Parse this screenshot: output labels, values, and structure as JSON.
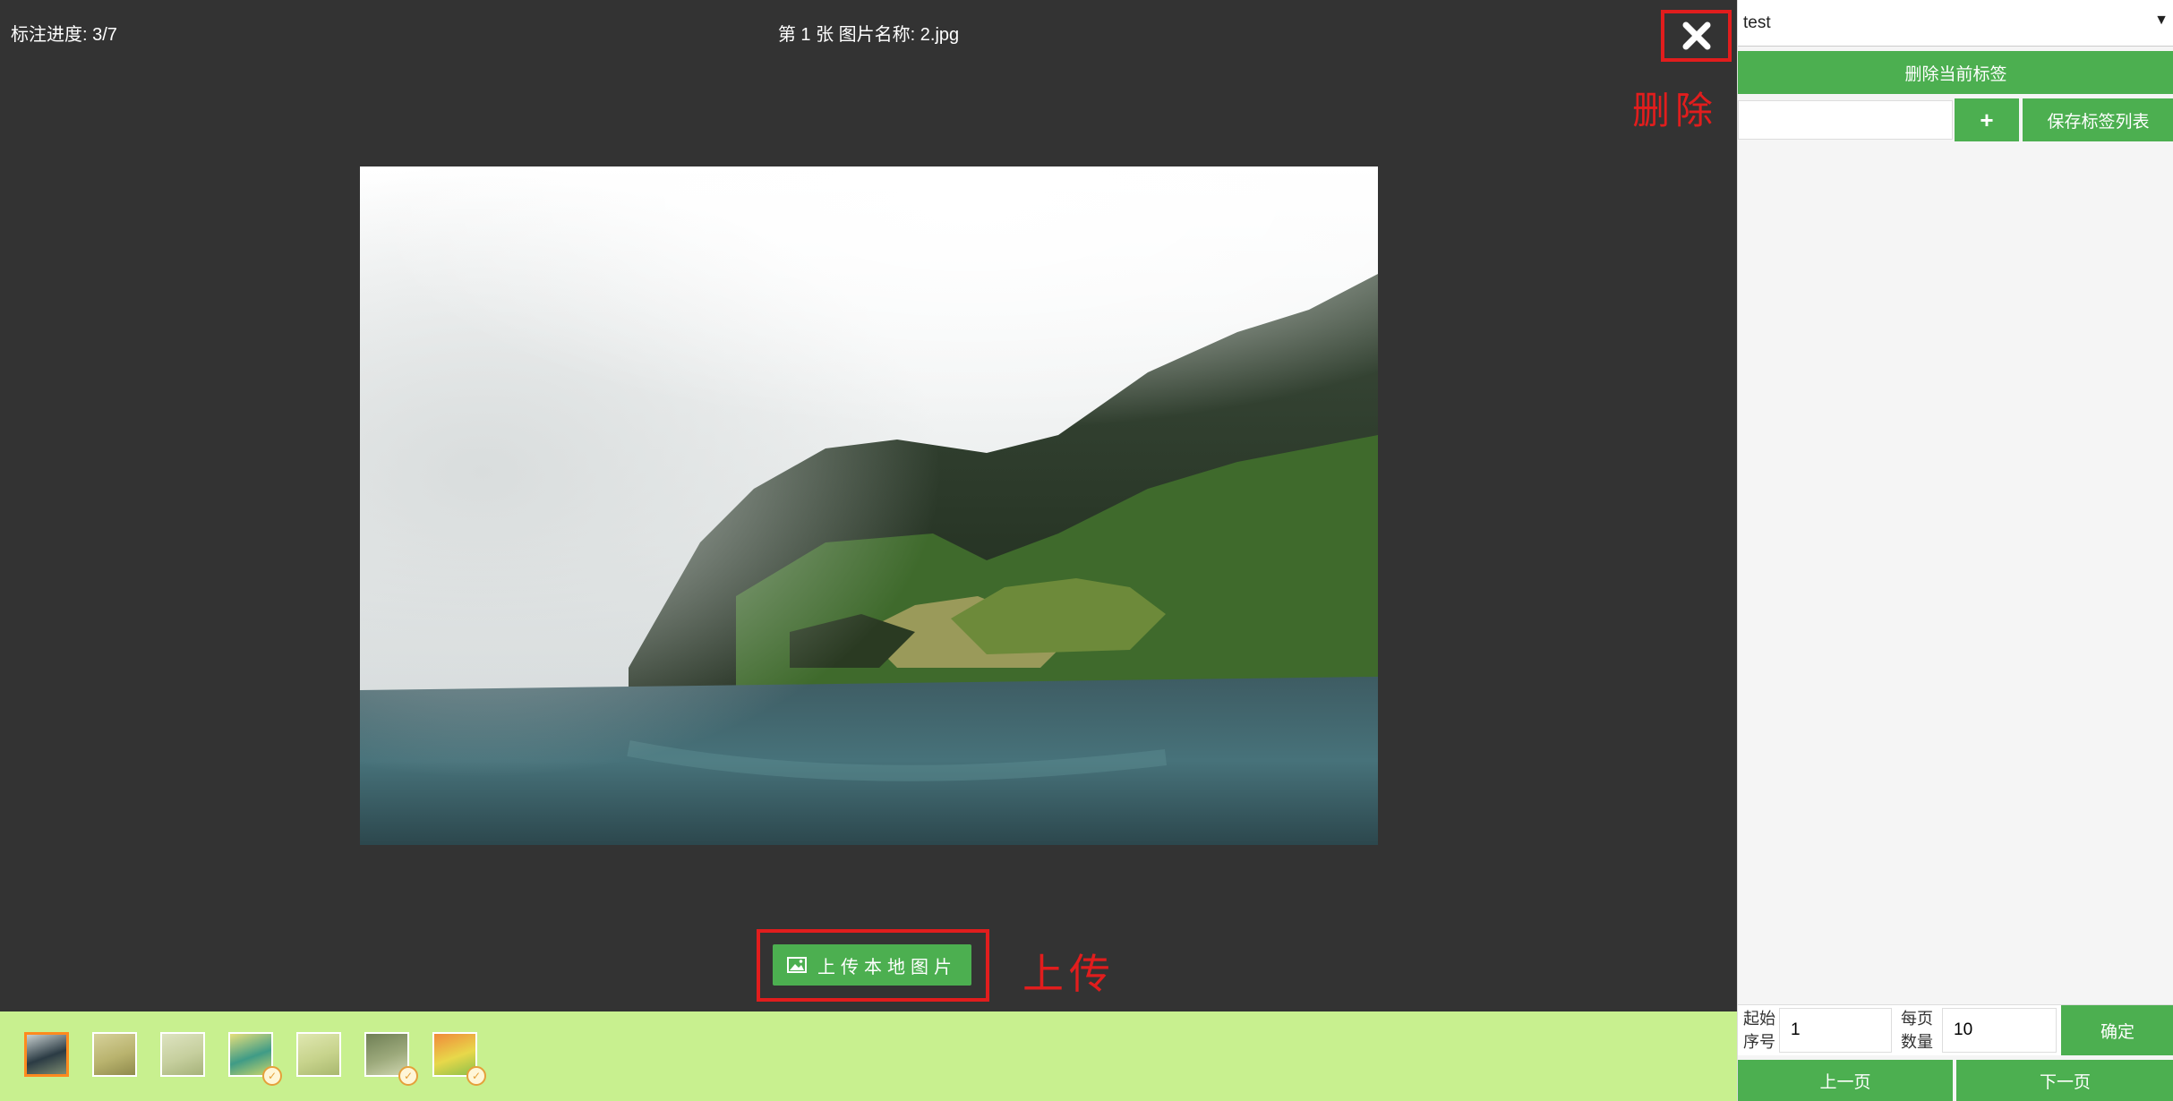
{
  "header": {
    "progress": "标注进度: 3/7",
    "image_title": "第 1 张 图片名称: 2.jpg",
    "close_icon": "close-x-icon"
  },
  "annotations": {
    "delete": "删除",
    "upload": "上传"
  },
  "main_image": {
    "description_icon": "landscape-photo"
  },
  "upload": {
    "icon": "image-icon",
    "label": "上传本地图片"
  },
  "thumbnails": [
    {
      "active": true,
      "checked": false,
      "colors": [
        "#2b3b44",
        "#7c8b70",
        "#c8d0d0"
      ]
    },
    {
      "active": false,
      "checked": false,
      "colors": [
        "#b9b36e",
        "#8f8a4c",
        "#d6d19a"
      ]
    },
    {
      "active": false,
      "checked": false,
      "colors": [
        "#c6cf9e",
        "#a6b27a",
        "#dde3c0"
      ]
    },
    {
      "active": false,
      "checked": true,
      "colors": [
        "#3f9b86",
        "#c9d76c",
        "#e6e07c"
      ]
    },
    {
      "active": false,
      "checked": false,
      "colors": [
        "#c7d38c",
        "#a9b86f",
        "#dfe7b0"
      ]
    },
    {
      "active": false,
      "checked": true,
      "colors": [
        "#9ca97b",
        "#cfd6b0",
        "#6f7f55"
      ]
    },
    {
      "active": false,
      "checked": true,
      "colors": [
        "#e8d84a",
        "#8cc04a",
        "#f08a3a"
      ]
    }
  ],
  "sidebar": {
    "select_value": "test",
    "delete_label_btn": "删除当前标签",
    "new_label_value": "",
    "add_btn": "+",
    "save_labels_btn": "保存标签列表",
    "start_label_line1": "起始",
    "start_label_line2": "序号",
    "start_value": "1",
    "per_page_line1": "每页",
    "per_page_line2": "数量",
    "per_page_value": "10",
    "confirm_btn": "确定",
    "prev_btn": "上一页",
    "next_btn": "下一页"
  },
  "colors": {
    "accent_green": "#4caf50",
    "annotation_red": "#e11d1d",
    "viewer_bg": "#333333",
    "thumb_strip_bg": "#c8f08f"
  }
}
